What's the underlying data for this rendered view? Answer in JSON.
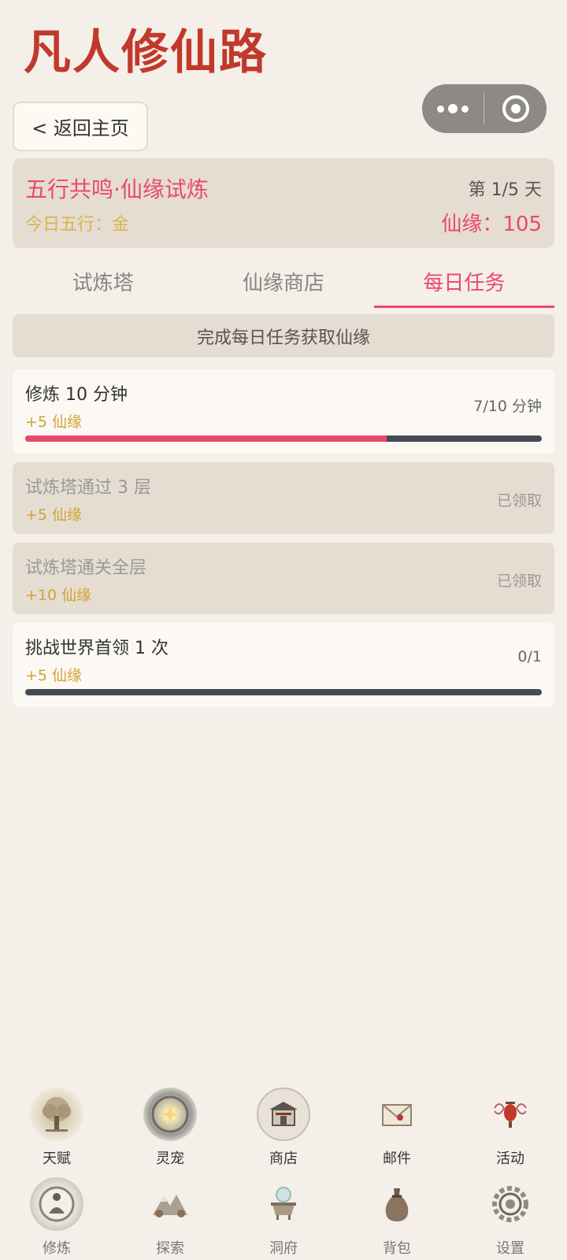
{
  "app": {
    "title": "凡人修仙路"
  },
  "header": {
    "back_label": "< 返回主页"
  },
  "event": {
    "title": "五行共鸣·仙缘试炼",
    "day": "第 1/5 天",
    "element": "今日五行：金",
    "points": "仙缘：105"
  },
  "tabs": [
    {
      "label": "试炼塔",
      "active": false
    },
    {
      "label": "仙缘商店",
      "active": false
    },
    {
      "label": "每日任务",
      "active": true
    }
  ],
  "banner": "完成每日任务获取仙缘",
  "tasks": [
    {
      "name": "修炼 10 分钟",
      "reward": "+5 仙缘",
      "progress": "7/10 分钟",
      "fill": 0.7
    },
    {
      "name": "试炼塔通过 3 层",
      "reward": "+5 仙缘",
      "status": "已领取"
    },
    {
      "name": "试炼塔通关全层",
      "reward": "+10 仙缘",
      "status": "已领取"
    },
    {
      "name": "挑战世界首领 1 次",
      "reward": "+5 仙缘",
      "progress": "0/1",
      "fill": 0
    }
  ],
  "nav": {
    "row1": [
      {
        "label": "天赋",
        "icon": "tree-icon"
      },
      {
        "label": "灵宠",
        "icon": "spirit-pet-icon"
      },
      {
        "label": "商店",
        "icon": "shop-icon"
      },
      {
        "label": "邮件",
        "icon": "mail-icon"
      },
      {
        "label": "活动",
        "icon": "lantern-icon"
      }
    ],
    "row2": [
      {
        "label": "修炼",
        "icon": "meditation-icon"
      },
      {
        "label": "探索",
        "icon": "mountain-icon"
      },
      {
        "label": "洞府",
        "icon": "cauldron-icon"
      },
      {
        "label": "背包",
        "icon": "bag-icon"
      },
      {
        "label": "设置",
        "icon": "gear-icon"
      }
    ]
  },
  "colors": {
    "brand": "#c0392b",
    "accent": "#e84a6b",
    "gold": "#d1a334",
    "background": "#f4efe8"
  }
}
